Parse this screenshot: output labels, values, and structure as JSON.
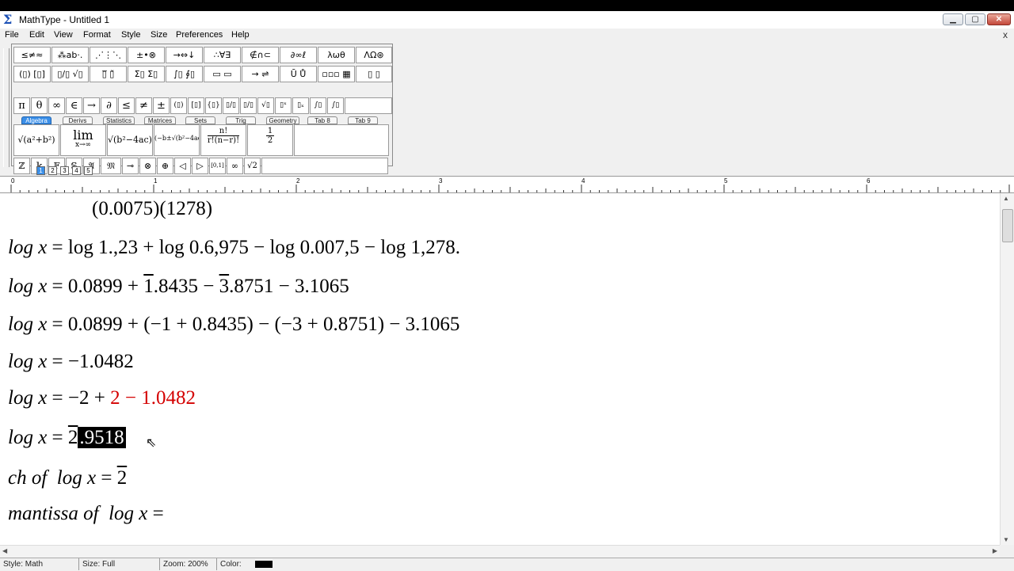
{
  "window": {
    "title": "MathType - Untitled 1",
    "min": "▁",
    "max": "▢",
    "close": "✕"
  },
  "menu": [
    "File",
    "Edit",
    "View",
    "Format",
    "Style",
    "Size",
    "Preferences",
    "Help"
  ],
  "menu_close": "x",
  "palette": {
    "row1": [
      "≤≠≈",
      "⁂ab·.",
      "⋰⋮⋱",
      "±•⊗",
      "→⇔↓",
      "∴∀∃",
      "∉∩⊂",
      "∂∞ℓ",
      "λωθ",
      "ΛΩ⊛"
    ],
    "row2": [
      "(▯) [▯]",
      "▯/▯ √▯",
      "▯̅ ▯̃",
      "Σ▯ Σ▯",
      "∫▯ ∮▯",
      "▭ ▭",
      "→ ⇌",
      "Ū Ů",
      "▫▫▫ ▦",
      "▯ ▯"
    ],
    "bar_symbols": [
      "π",
      "θ",
      "∞",
      "∈",
      "→",
      "∂",
      "≤",
      "≠",
      "±",
      "(▯)",
      "[▯]",
      "{▯}",
      "▯/▯",
      "▯/▯",
      "√▯",
      "▯ˣ",
      "▯ₓ",
      "∫▯",
      "∫▯"
    ],
    "tabs": [
      "Algebra",
      "Derivs",
      "Statistics",
      "Matrices",
      "Sets",
      "Trig",
      "Geometry",
      "Tab 8",
      "Tab 9"
    ],
    "templates": [
      {
        "label": "√(a²+b²)"
      },
      {
        "top": "lim",
        "bottom": "x→∞"
      },
      {
        "label": "√(b²−4ac)"
      },
      {
        "label": "(−b±√(b²−4ac))/2a"
      },
      {
        "num": "n!",
        "den": "r!(n−r)!"
      },
      {
        "num": "1",
        "den": "2"
      }
    ],
    "row5": [
      "ℤ",
      "𝕜",
      "𝔽",
      "𝕊",
      "𝔄",
      "𝔐",
      "⊸",
      "⊗",
      "⊕",
      "◁",
      "▷",
      "[0,1]",
      "∞",
      "√2"
    ],
    "size_tabs": [
      "1",
      "2",
      "3",
      "4",
      "5"
    ]
  },
  "ruler": {
    "labels": [
      "0",
      "1",
      "2",
      "3",
      "4",
      "5",
      "6"
    ]
  },
  "document": {
    "line0": "(0.0075)(1278)",
    "line1": {
      "lhs": "log x",
      "rest": " = log 1.,23 + log 0.6,975 − log 0.007,5 − log 1,278."
    },
    "line2": {
      "lhs": "log x",
      "a": " = 0.0899 + ",
      "bar1": "1",
      "b": ".8435 − ",
      "bar2": "3",
      "c": ".8751 − 3.1065"
    },
    "line3": {
      "lhs": "log x",
      "rest": " = 0.0899 + (−1 + 0.8435) − (−3 + 0.8751) − 3.1065"
    },
    "line4": {
      "lhs": "log x",
      "rest": " = −1.0482"
    },
    "line5": {
      "lhs": "log x",
      "a": " = −2 + ",
      "red": "2 − 1.0482"
    },
    "line6": {
      "lhs": "log x",
      "a": " = ",
      "bar": "2",
      "sel": ".9518"
    },
    "line7": {
      "label": "ch  of",
      "lhs": "log x",
      "a": " = ",
      "bar": "2"
    },
    "line8": {
      "label": "mantissa  of",
      "lhs": "log  x",
      "a": " ="
    }
  },
  "status": {
    "style": "Style: Math",
    "size": "Size: Full",
    "zoom": "Zoom: 200%",
    "color": "Color:",
    "color_value": "#000000"
  }
}
